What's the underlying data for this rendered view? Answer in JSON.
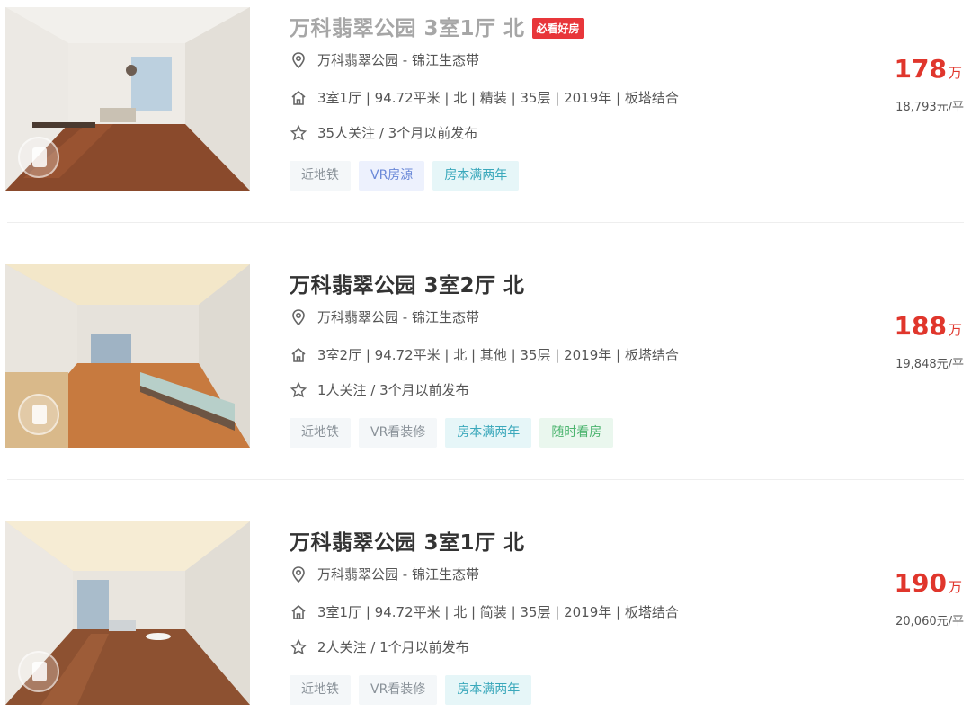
{
  "listings": [
    {
      "title": "万科翡翠公园 3室1厅 北",
      "badge": "必看好房",
      "location": "万科翡翠公园 - 锦江生态带",
      "info": "3室1厅 | 94.72平米 | 北 | 精装 | 35层 | 2019年 | 板塔结合",
      "follow": "35人关注 / 3个月以前发布",
      "tags": [
        "近地铁",
        "VR房源",
        "房本满两年"
      ],
      "price": "178",
      "price_unit": "万",
      "unit_price": "18,793元/平"
    },
    {
      "title": "万科翡翠公园 3室2厅 北",
      "location": "万科翡翠公园 - 锦江生态带",
      "info": "3室2厅 | 94.72平米 | 北 | 其他 | 35层 | 2019年 | 板塔结合",
      "follow": "1人关注 / 3个月以前发布",
      "tags": [
        "近地铁",
        "VR看装修",
        "房本满两年",
        "随时看房"
      ],
      "price": "188",
      "price_unit": "万",
      "unit_price": "19,848元/平"
    },
    {
      "title": "万科翡翠公园 3室1厅 北",
      "location": "万科翡翠公园 - 锦江生态带",
      "info": "3室1厅 | 94.72平米 | 北 | 简装 | 35层 | 2019年 | 板塔结合",
      "follow": "2人关注 / 1个月以前发布",
      "tags": [
        "近地铁",
        "VR看装修",
        "房本满两年"
      ],
      "price": "190",
      "price_unit": "万",
      "unit_price": "20,060元/平"
    }
  ],
  "colors": {
    "price": "#e0362c",
    "badge": "#e8363a",
    "tag_blue": "#6b89d8",
    "tag_cyan": "#3aa8bb",
    "tag_green": "#4bb46e"
  },
  "icons": {
    "location": "location-pin-icon",
    "house": "house-icon",
    "follow": "star-icon",
    "vr": "vr-view-icon"
  }
}
